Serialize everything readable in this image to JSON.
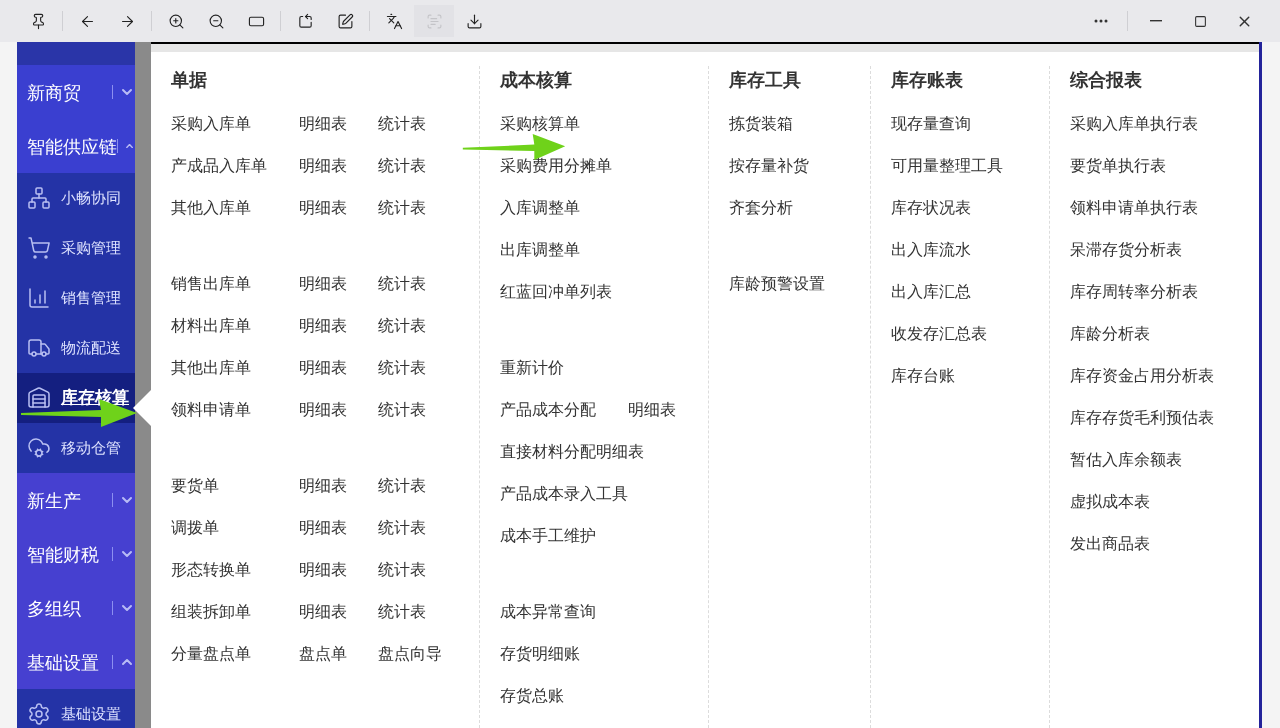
{
  "toolbar": {
    "buttons": [
      {
        "disabled": false
      },
      {
        "disabled": false
      },
      {
        "disabled": false
      },
      {
        "disabled": false
      },
      {
        "disabled": false
      },
      {
        "disabled": false
      },
      {
        "disabled": false
      },
      {
        "disabled": false
      },
      {
        "disabled": false
      },
      {
        "disabled": true
      },
      {
        "disabled": false
      }
    ]
  },
  "sidebar": {
    "sections": [
      {
        "label": "新商贸",
        "expanded": false
      },
      {
        "label": "智能供应链",
        "expanded": true,
        "children": [
          {
            "label": "小畅协同",
            "selected": false
          },
          {
            "label": "采购管理",
            "selected": false
          },
          {
            "label": "销售管理",
            "selected": false
          },
          {
            "label": "物流配送",
            "selected": false
          },
          {
            "label": "库存核算",
            "selected": true
          },
          {
            "label": "移动仓管",
            "selected": false
          }
        ]
      },
      {
        "label": "新生产",
        "expanded": false
      },
      {
        "label": "智能财税",
        "expanded": false
      },
      {
        "label": "多组织",
        "expanded": false
      },
      {
        "label": "基础设置",
        "expanded": true,
        "children": [
          {
            "label": "基础设置",
            "selected": false
          }
        ]
      }
    ]
  },
  "menu": {
    "columns": [
      {
        "title": "单据",
        "groups": [
          [
            [
              "采购入库单",
              "明细表",
              "统计表"
            ],
            [
              "产成品入库单",
              "明细表",
              "统计表"
            ],
            [
              "其他入库单",
              "明细表",
              "统计表"
            ]
          ],
          [
            [
              "销售出库单",
              "明细表",
              "统计表"
            ],
            [
              "材料出库单",
              "明细表",
              "统计表"
            ],
            [
              "其他出库单",
              "明细表",
              "统计表"
            ],
            [
              "领料申请单",
              "明细表",
              "统计表"
            ]
          ],
          [
            [
              "要货单",
              "明细表",
              "统计表"
            ],
            [
              "调拨单",
              "明细表",
              "统计表"
            ],
            [
              "形态转换单",
              "明细表",
              "统计表"
            ],
            [
              "组装拆卸单",
              "明细表",
              "统计表"
            ],
            [
              "分量盘点单",
              "盘点单",
              "盘点向导"
            ]
          ]
        ]
      },
      {
        "title": "成本核算",
        "groups": [
          [
            [
              "采购核算单"
            ],
            [
              "采购费用分摊单"
            ],
            [
              "入库调整单"
            ],
            [
              "出库调整单"
            ],
            [
              "红蓝回冲单列表"
            ]
          ],
          [
            [
              "重新计价"
            ],
            [
              "产品成本分配",
              "明细表"
            ],
            [
              "直接材料分配明细表"
            ],
            [
              "产品成本录入工具"
            ],
            [
              "成本手工维护"
            ]
          ],
          [
            [
              "成本异常查询"
            ],
            [
              "存货明细账"
            ],
            [
              "存货总账"
            ]
          ]
        ]
      },
      {
        "title": "库存工具",
        "groups": [
          [
            [
              "拣货装箱"
            ],
            [
              "按存量补货"
            ],
            [
              "齐套分析"
            ]
          ],
          [
            [
              "库龄预警设置"
            ]
          ]
        ]
      },
      {
        "title": "库存账表",
        "groups": [
          [
            [
              "现存量查询"
            ],
            [
              "可用量整理工具"
            ],
            [
              "库存状况表"
            ],
            [
              "出入库流水"
            ],
            [
              "出入库汇总"
            ],
            [
              "收发存汇总表"
            ],
            [
              "库存台账"
            ]
          ]
        ]
      },
      {
        "title": "综合报表",
        "groups": [
          [
            [
              "采购入库单执行表"
            ],
            [
              "要货单执行表"
            ],
            [
              "领料申请单执行表"
            ],
            [
              "呆滞存货分析表"
            ],
            [
              "库存周转率分析表"
            ],
            [
              "库龄分析表"
            ],
            [
              "库存资金占用分析表"
            ],
            [
              "库存存货毛利预估表"
            ],
            [
              "暂估入库余额表"
            ],
            [
              "虚拟成本表"
            ],
            [
              "发出商品表"
            ]
          ]
        ]
      }
    ]
  }
}
